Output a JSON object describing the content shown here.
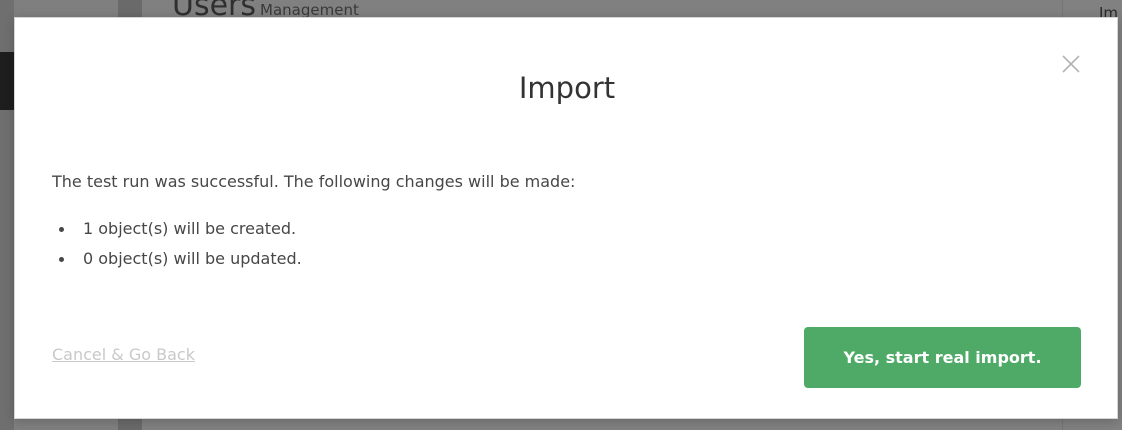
{
  "background": {
    "page_title": "Users",
    "page_subtitle": "Management",
    "right_panel_text": "Im"
  },
  "modal": {
    "title": "Import",
    "close_icon": "close-icon",
    "message": "The test run was successful. The following changes will be made:",
    "changes": [
      "1 object(s) will be created.",
      "0 object(s) will be updated."
    ],
    "cancel_label": "Cancel & Go Back",
    "confirm_label": "Yes, start real import."
  },
  "colors": {
    "overlay": "#7f7f7f",
    "modal_bg": "#ffffff",
    "confirm_button": "#4eaa66",
    "text": "#474747",
    "cancel_link": "#c9c9c9"
  }
}
